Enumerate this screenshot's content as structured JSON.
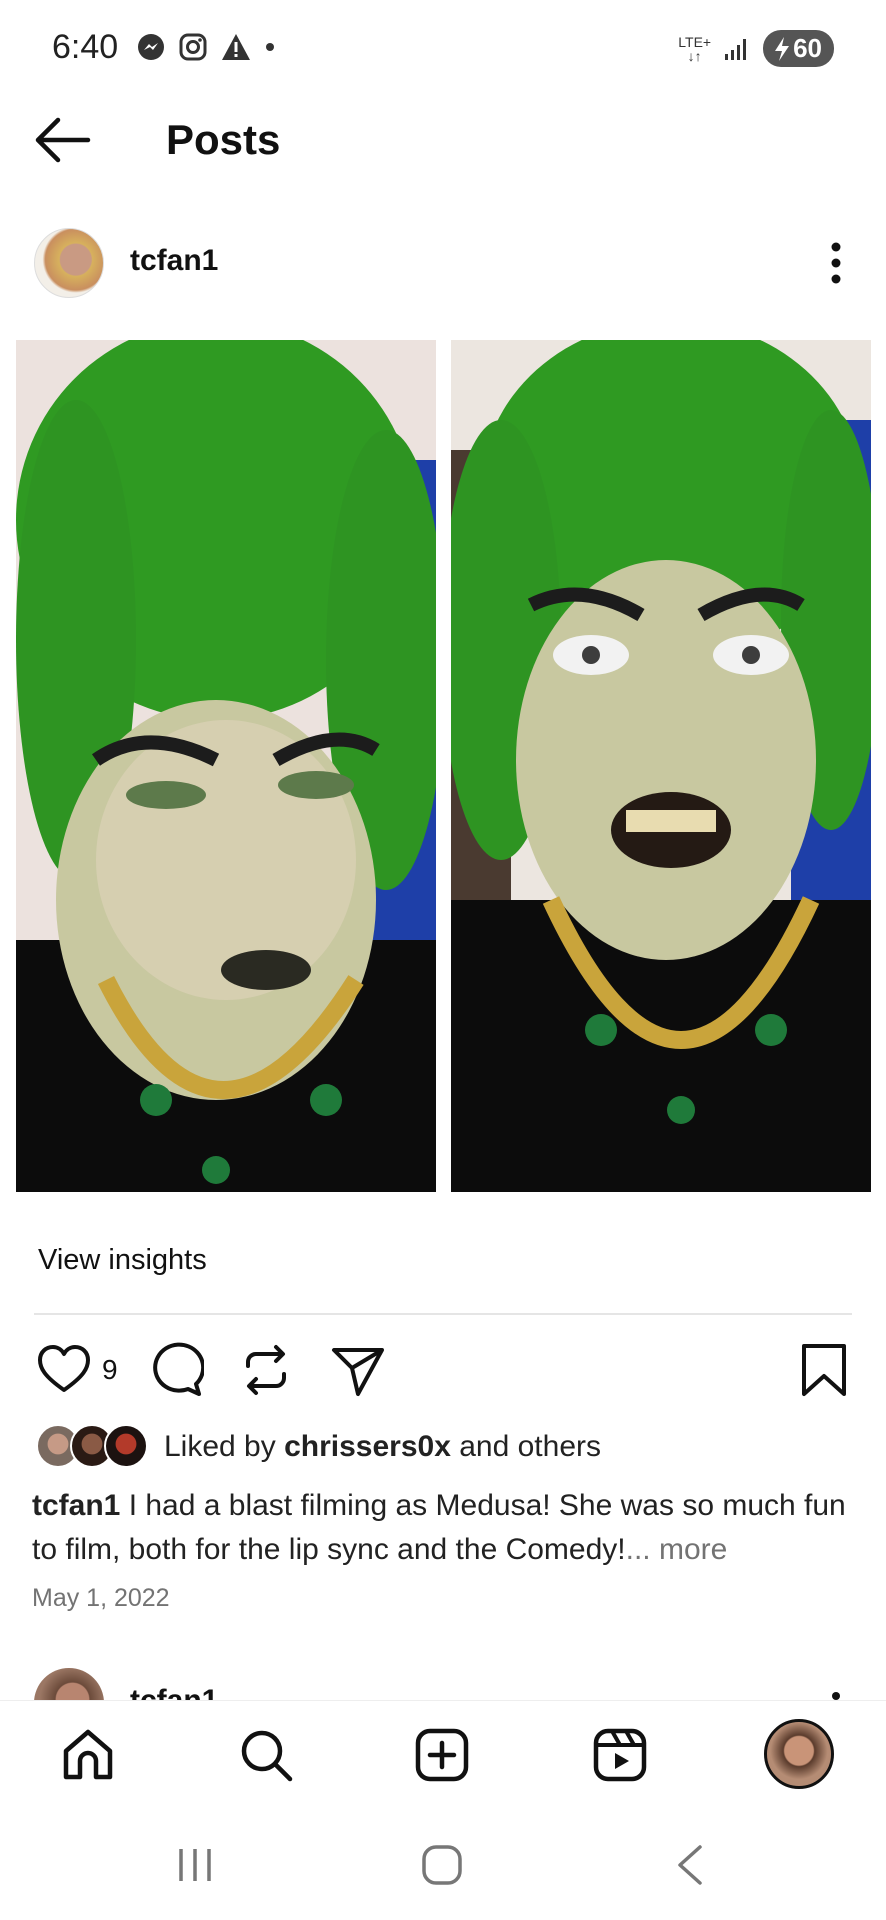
{
  "status_bar": {
    "time": "6:40",
    "network": "LTE+",
    "battery": "60",
    "left_icons": [
      "messenger-icon",
      "instagram-icon",
      "warning-icon",
      "dot-icon"
    ],
    "right_icons": [
      "lte-icon",
      "signal-icon",
      "battery-charging-icon"
    ]
  },
  "header": {
    "title": "Posts",
    "back_icon": "arrow-left-icon"
  },
  "post": {
    "username": "tcfan1",
    "images": [
      "medusa-costume-photo-1",
      "medusa-costume-photo-2"
    ],
    "insights_label": "View insights",
    "like_count": "9",
    "liked_by_prefix": "Liked by ",
    "liked_by_user": "chrissers0x",
    "liked_by_suffix": " and others",
    "caption_user": "tcfan1",
    "caption_text": " I had a blast filming as Medusa! She was so much fun to film, both for the lip sync and the Comedy!",
    "caption_more": "... more",
    "date": "May 1, 2022"
  },
  "next_post": {
    "username": "tcfan1"
  },
  "bottom_nav": {
    "items": [
      "home-icon",
      "search-icon",
      "new-post-icon",
      "reels-icon",
      "profile-avatar"
    ]
  },
  "system_nav": {
    "items": [
      "recents-icon",
      "home-icon",
      "back-icon"
    ]
  },
  "colors": {
    "secondary_text": "#737373",
    "text": "#111111",
    "divider": "#e5e5e5"
  }
}
